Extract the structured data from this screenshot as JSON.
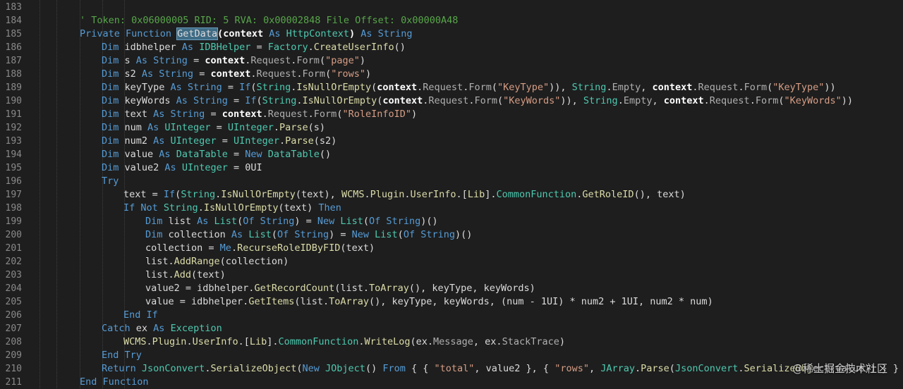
{
  "editor": {
    "theme_colors": {
      "background": "#1e1e1e",
      "keyword": "#569cd6",
      "type": "#4ec9b0",
      "method": "#dcdcaa",
      "string": "#d69d85",
      "comment": "#57a64a",
      "text": "#dcdcdc"
    },
    "lines": [
      {
        "n": "183",
        "indent": 0,
        "segs": []
      },
      {
        "n": "184",
        "indent": 0,
        "segs": [
          [
            "cm",
            "' Token: 0x06000005 RID: 5 RVA: 0x00002848 File Offset: 0x00000A48"
          ]
        ]
      },
      {
        "n": "185",
        "indent": 0,
        "segs": [
          [
            "kw",
            "Private Function "
          ],
          [
            "hl",
            "GetData"
          ],
          [
            "bd",
            "(context "
          ],
          [
            "kw",
            "As "
          ],
          [
            "ty",
            "HttpContext"
          ],
          [
            "bd",
            ") "
          ],
          [
            "kw",
            "As String"
          ]
        ]
      },
      {
        "n": "186",
        "indent": 1,
        "segs": [
          [
            "kw",
            "Dim "
          ],
          [
            "",
            "idbhelper "
          ],
          [
            "kw",
            "As "
          ],
          [
            "ty",
            "IDBHelper "
          ],
          [
            "",
            "= "
          ],
          [
            "ty",
            "Factory"
          ],
          [
            "",
            "."
          ],
          [
            "mt",
            "CreateUserInfo"
          ],
          [
            "",
            "()"
          ]
        ]
      },
      {
        "n": "187",
        "indent": 1,
        "segs": [
          [
            "kw",
            "Dim "
          ],
          [
            "",
            "s "
          ],
          [
            "kw",
            "As String "
          ],
          [
            "",
            "= "
          ],
          [
            "bd",
            "context"
          ],
          [
            "",
            "."
          ],
          [
            "pr",
            "Request"
          ],
          [
            "",
            "."
          ],
          [
            "pr",
            "Form"
          ],
          [
            "",
            "("
          ],
          [
            "st",
            "\"page\""
          ],
          [
            "",
            ")"
          ]
        ]
      },
      {
        "n": "188",
        "indent": 1,
        "segs": [
          [
            "kw",
            "Dim "
          ],
          [
            "",
            "s2 "
          ],
          [
            "kw",
            "As String "
          ],
          [
            "",
            "= "
          ],
          [
            "bd",
            "context"
          ],
          [
            "",
            "."
          ],
          [
            "pr",
            "Request"
          ],
          [
            "",
            "."
          ],
          [
            "pr",
            "Form"
          ],
          [
            "",
            "("
          ],
          [
            "st",
            "\"rows\""
          ],
          [
            "",
            ")"
          ]
        ]
      },
      {
        "n": "189",
        "indent": 1,
        "segs": [
          [
            "kw",
            "Dim "
          ],
          [
            "",
            "keyType "
          ],
          [
            "kw",
            "As String "
          ],
          [
            "",
            "= "
          ],
          [
            "kw",
            "If"
          ],
          [
            "",
            "("
          ],
          [
            "ty",
            "String"
          ],
          [
            "",
            "."
          ],
          [
            "mt",
            "IsNullOrEmpty"
          ],
          [
            "",
            "("
          ],
          [
            "bd",
            "context"
          ],
          [
            "",
            "."
          ],
          [
            "pr",
            "Request"
          ],
          [
            "",
            "."
          ],
          [
            "pr",
            "Form"
          ],
          [
            "",
            "("
          ],
          [
            "st",
            "\"KeyType\""
          ],
          [
            "",
            ")), "
          ],
          [
            "ty",
            "String"
          ],
          [
            "",
            "."
          ],
          [
            "pr",
            "Empty"
          ],
          [
            "",
            ", "
          ],
          [
            "bd",
            "context"
          ],
          [
            "",
            "."
          ],
          [
            "pr",
            "Request"
          ],
          [
            "",
            "."
          ],
          [
            "pr",
            "Form"
          ],
          [
            "",
            "("
          ],
          [
            "st",
            "\"KeyType\""
          ],
          [
            "",
            "))"
          ]
        ]
      },
      {
        "n": "190",
        "indent": 1,
        "segs": [
          [
            "kw",
            "Dim "
          ],
          [
            "",
            "keyWords "
          ],
          [
            "kw",
            "As String "
          ],
          [
            "",
            "= "
          ],
          [
            "kw",
            "If"
          ],
          [
            "",
            "("
          ],
          [
            "ty",
            "String"
          ],
          [
            "",
            "."
          ],
          [
            "mt",
            "IsNullOrEmpty"
          ],
          [
            "",
            "("
          ],
          [
            "bd",
            "context"
          ],
          [
            "",
            "."
          ],
          [
            "pr",
            "Request"
          ],
          [
            "",
            "."
          ],
          [
            "pr",
            "Form"
          ],
          [
            "",
            "("
          ],
          [
            "st",
            "\"KeyWords\""
          ],
          [
            "",
            ")), "
          ],
          [
            "ty",
            "String"
          ],
          [
            "",
            "."
          ],
          [
            "pr",
            "Empty"
          ],
          [
            "",
            ", "
          ],
          [
            "bd",
            "context"
          ],
          [
            "",
            "."
          ],
          [
            "pr",
            "Request"
          ],
          [
            "",
            "."
          ],
          [
            "pr",
            "Form"
          ],
          [
            "",
            "("
          ],
          [
            "st",
            "\"KeyWords\""
          ],
          [
            "",
            "))"
          ]
        ]
      },
      {
        "n": "191",
        "indent": 1,
        "segs": [
          [
            "kw",
            "Dim "
          ],
          [
            "",
            "text "
          ],
          [
            "kw",
            "As String "
          ],
          [
            "",
            "= "
          ],
          [
            "bd",
            "context"
          ],
          [
            "",
            "."
          ],
          [
            "pr",
            "Request"
          ],
          [
            "",
            "."
          ],
          [
            "pr",
            "Form"
          ],
          [
            "",
            "("
          ],
          [
            "st",
            "\"RoleInfoID\""
          ],
          [
            "",
            ")"
          ]
        ]
      },
      {
        "n": "192",
        "indent": 1,
        "segs": [
          [
            "kw",
            "Dim "
          ],
          [
            "",
            "num "
          ],
          [
            "kw",
            "As "
          ],
          [
            "ty",
            "UInteger "
          ],
          [
            "",
            "= "
          ],
          [
            "ty",
            "UInteger"
          ],
          [
            "",
            "."
          ],
          [
            "mt",
            "Parse"
          ],
          [
            "",
            "(s)"
          ]
        ]
      },
      {
        "n": "193",
        "indent": 1,
        "segs": [
          [
            "kw",
            "Dim "
          ],
          [
            "",
            "num2 "
          ],
          [
            "kw",
            "As "
          ],
          [
            "ty",
            "UInteger "
          ],
          [
            "",
            "= "
          ],
          [
            "ty",
            "UInteger"
          ],
          [
            "",
            "."
          ],
          [
            "mt",
            "Parse"
          ],
          [
            "",
            "(s2)"
          ]
        ]
      },
      {
        "n": "194",
        "indent": 1,
        "segs": [
          [
            "kw",
            "Dim "
          ],
          [
            "",
            "value "
          ],
          [
            "kw",
            "As "
          ],
          [
            "ty",
            "DataTable "
          ],
          [
            "",
            "= "
          ],
          [
            "kw",
            "New "
          ],
          [
            "ty",
            "DataTable"
          ],
          [
            "",
            "()"
          ]
        ]
      },
      {
        "n": "195",
        "indent": 1,
        "segs": [
          [
            "kw",
            "Dim "
          ],
          [
            "",
            "value2 "
          ],
          [
            "kw",
            "As "
          ],
          [
            "ty",
            "UInteger "
          ],
          [
            "",
            "= 0UI"
          ]
        ]
      },
      {
        "n": "196",
        "indent": 1,
        "segs": [
          [
            "kw",
            "Try"
          ]
        ]
      },
      {
        "n": "197",
        "indent": 2,
        "segs": [
          [
            "",
            "text = "
          ],
          [
            "kw",
            "If"
          ],
          [
            "",
            "("
          ],
          [
            "ty",
            "String"
          ],
          [
            "",
            "."
          ],
          [
            "mt",
            "IsNullOrEmpty"
          ],
          [
            "",
            "(text), "
          ],
          [
            "mt",
            "WCMS"
          ],
          [
            "",
            "."
          ],
          [
            "mt",
            "Plugin"
          ],
          [
            "",
            "."
          ],
          [
            "mt",
            "UserInfo"
          ],
          [
            "",
            ".["
          ],
          [
            "mt",
            "Lib"
          ],
          [
            "",
            "]."
          ],
          [
            "ty",
            "CommonFunction"
          ],
          [
            "",
            "."
          ],
          [
            "mt",
            "GetRoleID"
          ],
          [
            "",
            "(), text)"
          ]
        ]
      },
      {
        "n": "198",
        "indent": 2,
        "segs": [
          [
            "kw",
            "If Not "
          ],
          [
            "ty",
            "String"
          ],
          [
            "",
            "."
          ],
          [
            "mt",
            "IsNullOrEmpty"
          ],
          [
            "",
            "(text) "
          ],
          [
            "kw",
            "Then"
          ]
        ]
      },
      {
        "n": "199",
        "indent": 3,
        "segs": [
          [
            "kw",
            "Dim "
          ],
          [
            "",
            "list "
          ],
          [
            "kw",
            "As "
          ],
          [
            "ty",
            "List"
          ],
          [
            "",
            "("
          ],
          [
            "kw",
            "Of String"
          ],
          [
            "",
            ") = "
          ],
          [
            "kw",
            "New "
          ],
          [
            "ty",
            "List"
          ],
          [
            "",
            "("
          ],
          [
            "kw",
            "Of String"
          ],
          [
            "",
            ")()"
          ]
        ]
      },
      {
        "n": "200",
        "indent": 3,
        "segs": [
          [
            "kw",
            "Dim "
          ],
          [
            "",
            "collection "
          ],
          [
            "kw",
            "As "
          ],
          [
            "ty",
            "List"
          ],
          [
            "",
            "("
          ],
          [
            "kw",
            "Of String"
          ],
          [
            "",
            ") = "
          ],
          [
            "kw",
            "New "
          ],
          [
            "ty",
            "List"
          ],
          [
            "",
            "("
          ],
          [
            "kw",
            "Of String"
          ],
          [
            "",
            ")()"
          ]
        ]
      },
      {
        "n": "201",
        "indent": 3,
        "segs": [
          [
            "",
            "collection = "
          ],
          [
            "kw",
            "Me"
          ],
          [
            "",
            "."
          ],
          [
            "mt",
            "RecurseRoleIDByFID"
          ],
          [
            "",
            "(text)"
          ]
        ]
      },
      {
        "n": "202",
        "indent": 3,
        "segs": [
          [
            "",
            "list."
          ],
          [
            "mt",
            "AddRange"
          ],
          [
            "",
            "(collection)"
          ]
        ]
      },
      {
        "n": "203",
        "indent": 3,
        "segs": [
          [
            "",
            "list."
          ],
          [
            "mt",
            "Add"
          ],
          [
            "",
            "(text)"
          ]
        ]
      },
      {
        "n": "204",
        "indent": 3,
        "segs": [
          [
            "",
            "value2 = idbhelper."
          ],
          [
            "mt",
            "GetRecordCount"
          ],
          [
            "",
            "(list."
          ],
          [
            "mt",
            "ToArray"
          ],
          [
            "",
            "(), keyType, keyWords)"
          ]
        ]
      },
      {
        "n": "205",
        "indent": 3,
        "segs": [
          [
            "",
            "value = idbhelper."
          ],
          [
            "mt",
            "GetItems"
          ],
          [
            "",
            "(list."
          ],
          [
            "mt",
            "ToArray"
          ],
          [
            "",
            "(), keyType, keyWords, (num - 1UI) * num2 + 1UI, num2 * num)"
          ]
        ]
      },
      {
        "n": "206",
        "indent": 2,
        "segs": [
          [
            "kw",
            "End If"
          ]
        ]
      },
      {
        "n": "207",
        "indent": 1,
        "segs": [
          [
            "kw",
            "Catch "
          ],
          [
            "",
            "ex "
          ],
          [
            "kw",
            "As "
          ],
          [
            "ty",
            "Exception"
          ]
        ]
      },
      {
        "n": "208",
        "indent": 2,
        "segs": [
          [
            "mt",
            "WCMS"
          ],
          [
            "",
            "."
          ],
          [
            "mt",
            "Plugin"
          ],
          [
            "",
            "."
          ],
          [
            "mt",
            "UserInfo"
          ],
          [
            "",
            ".["
          ],
          [
            "mt",
            "Lib"
          ],
          [
            "",
            "]."
          ],
          [
            "ty",
            "CommonFunction"
          ],
          [
            "",
            "."
          ],
          [
            "mt",
            "WriteLog"
          ],
          [
            "",
            "(ex."
          ],
          [
            "pr",
            "Message"
          ],
          [
            "",
            ", ex."
          ],
          [
            "pr",
            "StackTrace"
          ],
          [
            "",
            ")"
          ]
        ]
      },
      {
        "n": "209",
        "indent": 1,
        "segs": [
          [
            "kw",
            "End Try"
          ]
        ]
      },
      {
        "n": "210",
        "indent": 1,
        "segs": [
          [
            "kw",
            "Return "
          ],
          [
            "ty",
            "JsonConvert"
          ],
          [
            "",
            "."
          ],
          [
            "mt",
            "SerializeObject"
          ],
          [
            "",
            "("
          ],
          [
            "kw",
            "New "
          ],
          [
            "ty",
            "JObject"
          ],
          [
            "",
            "() "
          ],
          [
            "kw",
            "From "
          ],
          [
            "",
            "{ { "
          ],
          [
            "st",
            "\"total\""
          ],
          [
            "",
            ", value2 }, { "
          ],
          [
            "st",
            "\"rows\""
          ],
          [
            "",
            ", "
          ],
          [
            "ty",
            "JArray"
          ],
          [
            "",
            "."
          ],
          [
            "mt",
            "Parse"
          ],
          [
            "",
            "("
          ],
          [
            "ty",
            "JsonConvert"
          ],
          [
            "",
            "."
          ],
          [
            "mt",
            "SerializeObj"
          ],
          [
            "",
            "ect(value)) } }"
          ]
        ]
      },
      {
        "n": "211",
        "indent": 0,
        "segs": [
          [
            "kw",
            "End Function"
          ]
        ]
      }
    ]
  },
  "watermark": "@稀土掘金技术社区"
}
